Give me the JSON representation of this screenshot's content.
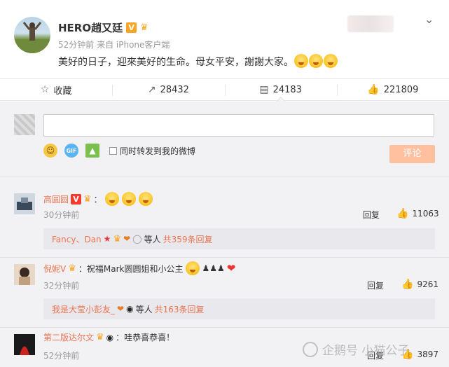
{
  "post": {
    "author": "HERO趙又廷",
    "time_source": "52分钟前 来自 iPhone客户端",
    "text": "美好的日子，迎來美好的生命。母女平安，謝謝大家。",
    "verified_badge": "V",
    "emoji_count": 3
  },
  "actions": {
    "favorite_label": "收藏",
    "repost_count": "28432",
    "comment_count": "24183",
    "like_count": "221809"
  },
  "composer": {
    "input_value": "",
    "forward_label": "同时转发到我的微博",
    "submit_label": "评论",
    "gif_label": "GIF"
  },
  "comments": [
    {
      "name": "高圆圆",
      "text": "：",
      "time": "30分钟前",
      "reply_label": "回复",
      "likes": "11063",
      "sub": {
        "names": "Fancy、Dan",
        "who": "等人",
        "total": "共359条回复"
      }
    },
    {
      "name": "倪妮V",
      "text": "：祝福Mark圆圆姐和小公主",
      "time": "32分钟前",
      "reply_label": "回复",
      "likes": "9261",
      "sub": {
        "names": "我是大莹小彭友_",
        "who": "等人",
        "total": "共163条回复"
      }
    },
    {
      "name": "第二版达尔文",
      "text": "：哇恭喜恭喜！",
      "time": "52分钟前",
      "reply_label": "回复",
      "likes": "3897"
    }
  ],
  "watermark": "企鹅号 小猫公子",
  "colors": {
    "accent": "#eb7350",
    "submit_bg": "#ffc09f",
    "panel_bg": "#f2f2f5"
  }
}
